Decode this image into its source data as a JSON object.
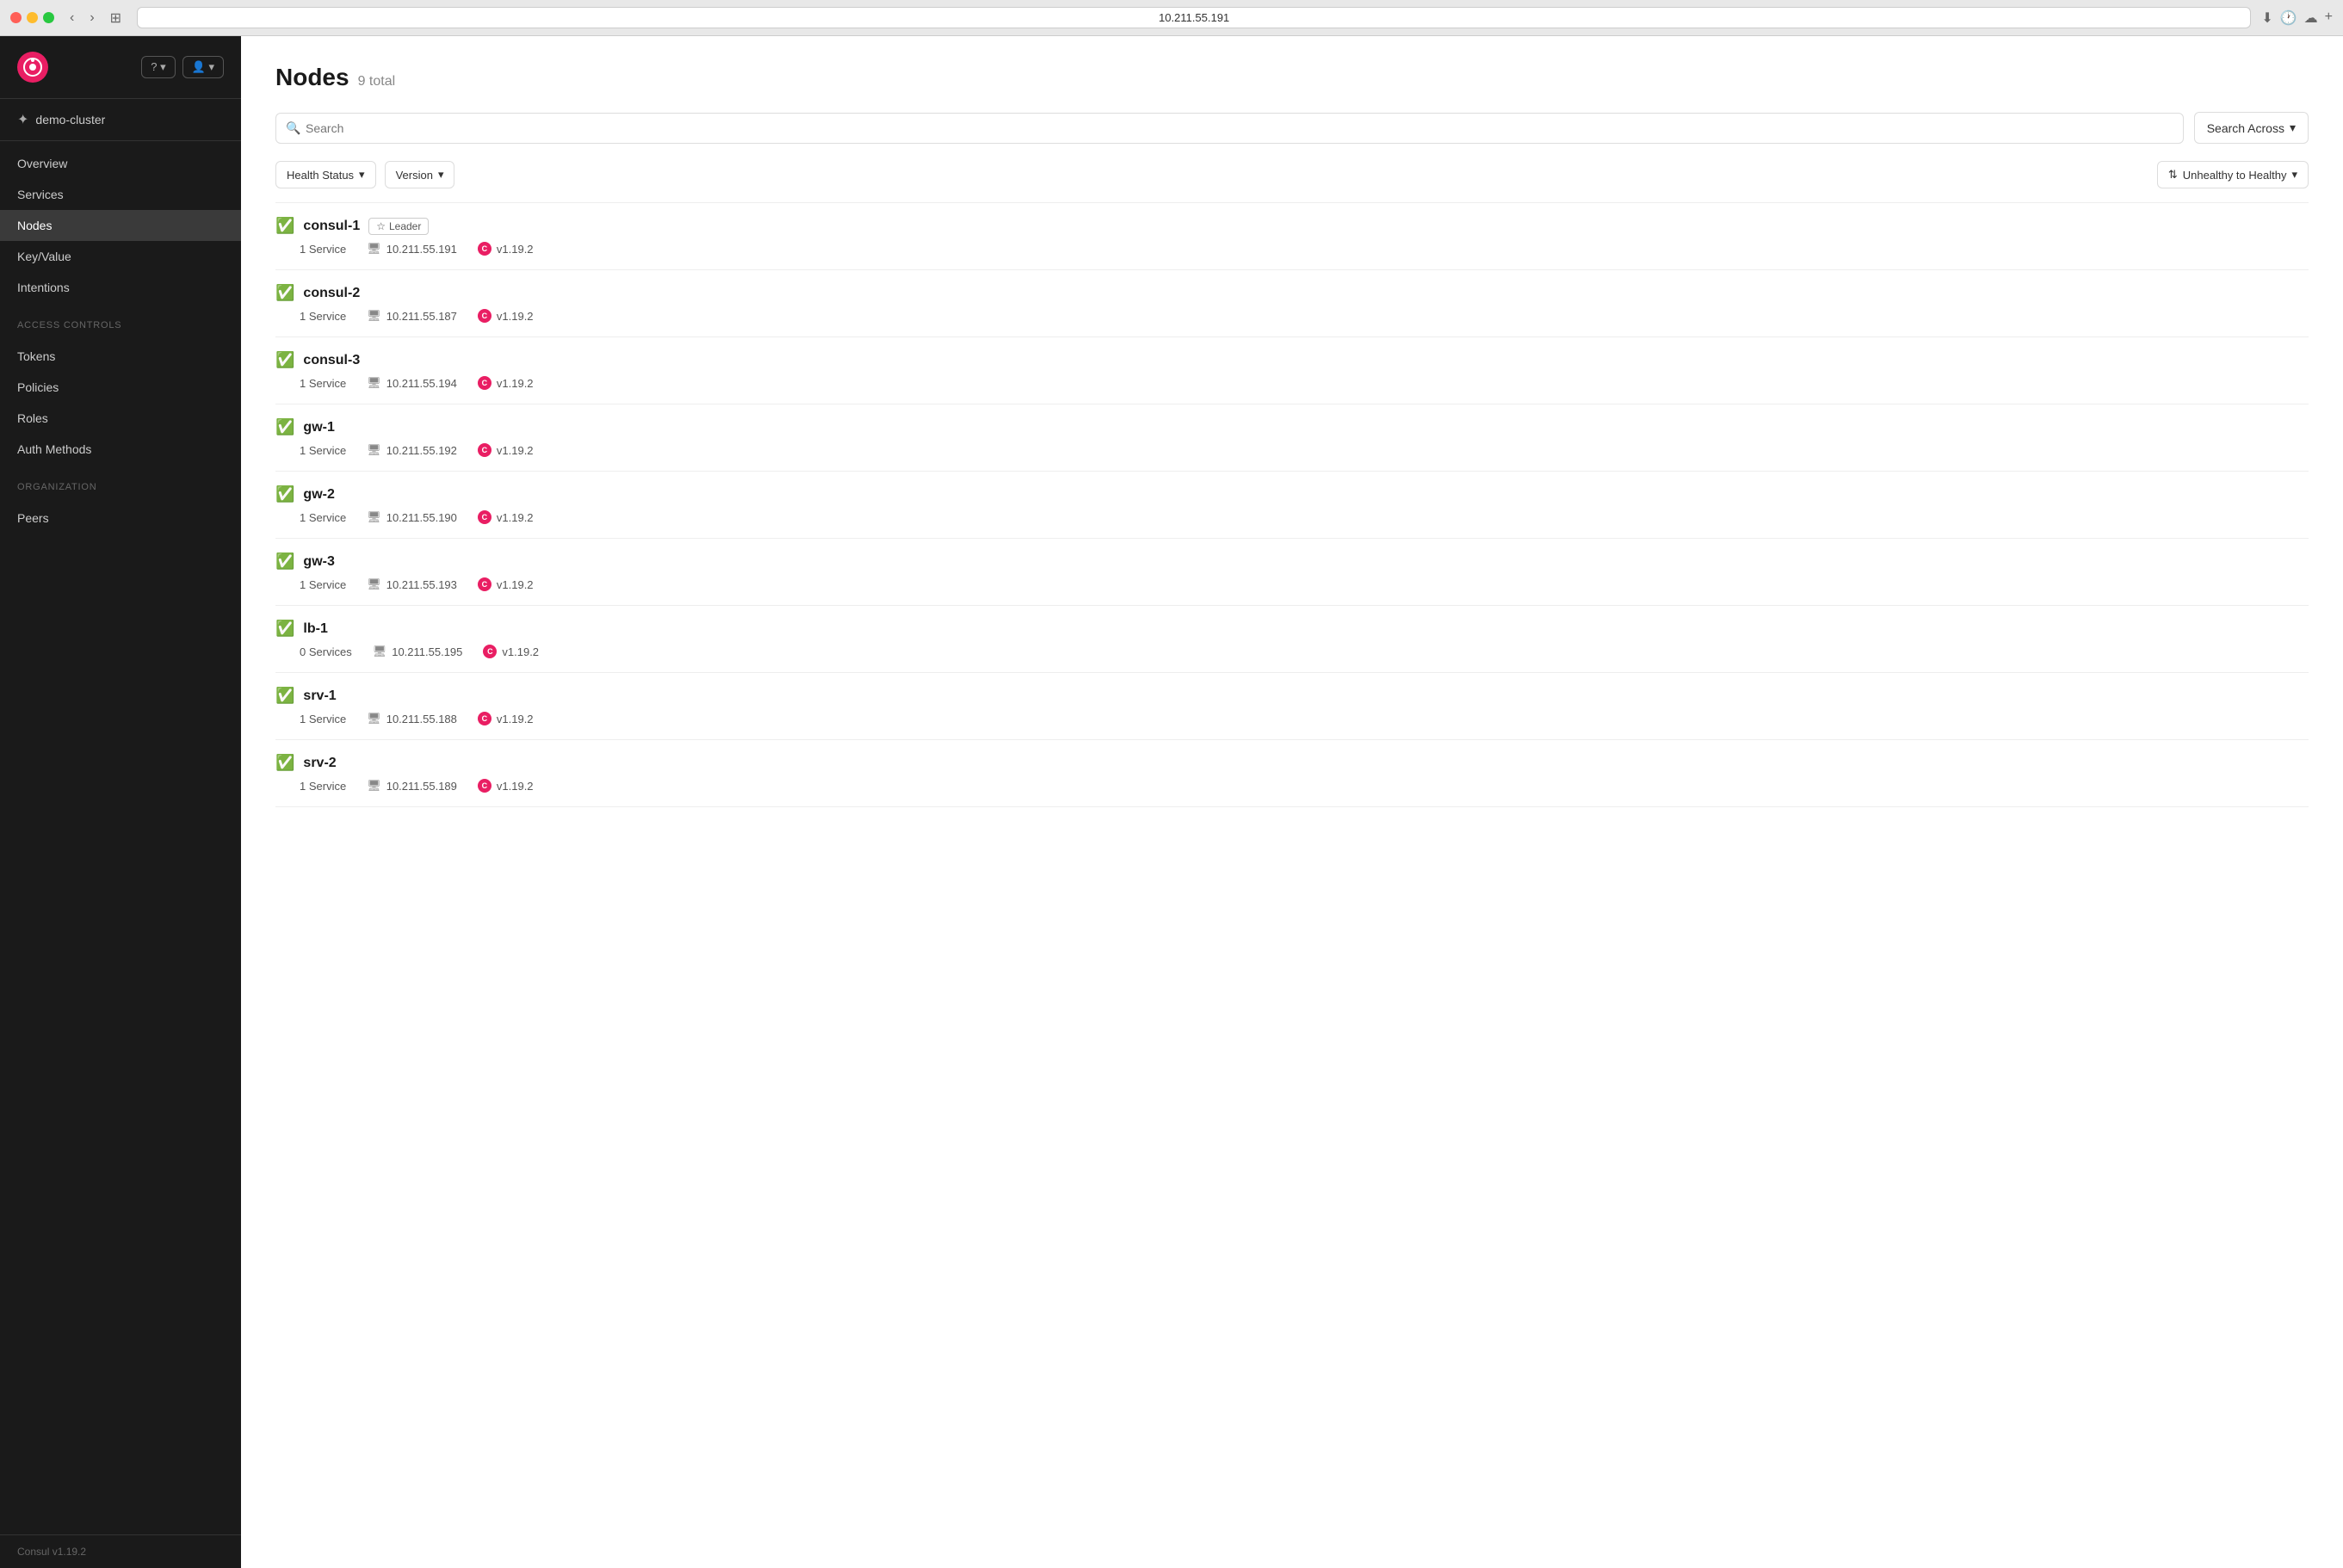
{
  "browser": {
    "url": "10.211.55.191"
  },
  "sidebar": {
    "logo_text": "C",
    "cluster_name": "demo-cluster",
    "help_button": "?",
    "user_button": "👤",
    "nav_items": [
      {
        "id": "overview",
        "label": "Overview",
        "active": false
      },
      {
        "id": "services",
        "label": "Services",
        "active": false
      },
      {
        "id": "nodes",
        "label": "Nodes",
        "active": true
      }
    ],
    "key_value": "Key/Value",
    "intentions": "Intentions",
    "access_controls_label": "Access Controls",
    "access_controls_items": [
      {
        "id": "tokens",
        "label": "Tokens"
      },
      {
        "id": "policies",
        "label": "Policies"
      },
      {
        "id": "roles",
        "label": "Roles"
      },
      {
        "id": "auth-methods",
        "label": "Auth Methods"
      }
    ],
    "organization_label": "Organization",
    "organization_items": [
      {
        "id": "peers",
        "label": "Peers"
      }
    ],
    "footer": "Consul v1.19.2"
  },
  "main": {
    "page_title": "Nodes",
    "page_count": "9 total",
    "search_placeholder": "Search",
    "search_across_label": "Search Across",
    "health_status_filter": "Health Status",
    "version_filter": "Version",
    "sort_label": "Unhealthy to Healthy",
    "nodes": [
      {
        "id": "consul-1",
        "name": "consul-1",
        "healthy": true,
        "is_leader": true,
        "leader_label": "Leader",
        "services": "1 Service",
        "ip": "10.211.55.191",
        "version": "v1.19.2"
      },
      {
        "id": "consul-2",
        "name": "consul-2",
        "healthy": true,
        "is_leader": false,
        "services": "1 Service",
        "ip": "10.211.55.187",
        "version": "v1.19.2"
      },
      {
        "id": "consul-3",
        "name": "consul-3",
        "healthy": true,
        "is_leader": false,
        "services": "1 Service",
        "ip": "10.211.55.194",
        "version": "v1.19.2"
      },
      {
        "id": "gw-1",
        "name": "gw-1",
        "healthy": true,
        "is_leader": false,
        "services": "1 Service",
        "ip": "10.211.55.192",
        "version": "v1.19.2"
      },
      {
        "id": "gw-2",
        "name": "gw-2",
        "healthy": true,
        "is_leader": false,
        "services": "1 Service",
        "ip": "10.211.55.190",
        "version": "v1.19.2"
      },
      {
        "id": "gw-3",
        "name": "gw-3",
        "healthy": true,
        "is_leader": false,
        "services": "1 Service",
        "ip": "10.211.55.193",
        "version": "v1.19.2"
      },
      {
        "id": "lb-1",
        "name": "lb-1",
        "healthy": true,
        "is_leader": false,
        "services": "0 Services",
        "ip": "10.211.55.195",
        "version": "v1.19.2"
      },
      {
        "id": "srv-1",
        "name": "srv-1",
        "healthy": true,
        "is_leader": false,
        "services": "1 Service",
        "ip": "10.211.55.188",
        "version": "v1.19.2"
      },
      {
        "id": "srv-2",
        "name": "srv-2",
        "healthy": true,
        "is_leader": false,
        "services": "1 Service",
        "ip": "10.211.55.189",
        "version": "v1.19.2"
      }
    ]
  }
}
